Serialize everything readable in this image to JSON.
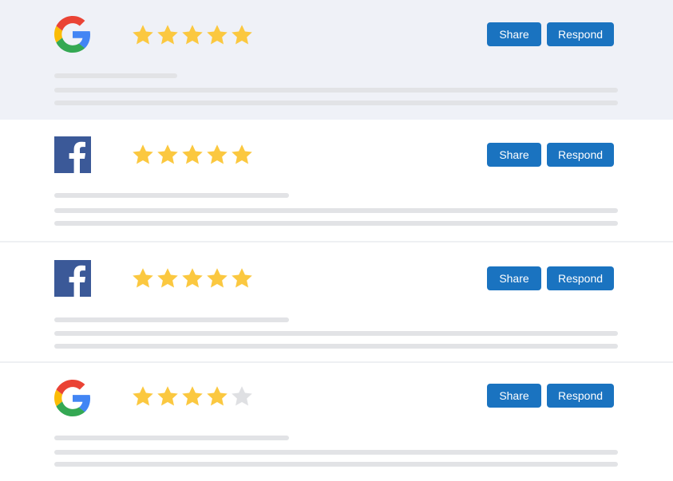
{
  "colors": {
    "button": "#1a73c0",
    "star_filled": "#fbc840",
    "star_empty": "#dfe0e3",
    "facebook": "#3b5998",
    "highlight_row": "#eff1f7",
    "placeholder_line": "#e2e3e6"
  },
  "reviews": [
    {
      "source": "google-icon",
      "rating": 5,
      "share_label": "Share",
      "respond_label": "Respond"
    },
    {
      "source": "facebook-icon",
      "rating": 5,
      "share_label": "Share",
      "respond_label": "Respond"
    },
    {
      "source": "facebook-icon",
      "rating": 5,
      "share_label": "Share",
      "respond_label": "Respond"
    },
    {
      "source": "google-icon",
      "rating": 4,
      "share_label": "Share",
      "respond_label": "Respond"
    }
  ]
}
